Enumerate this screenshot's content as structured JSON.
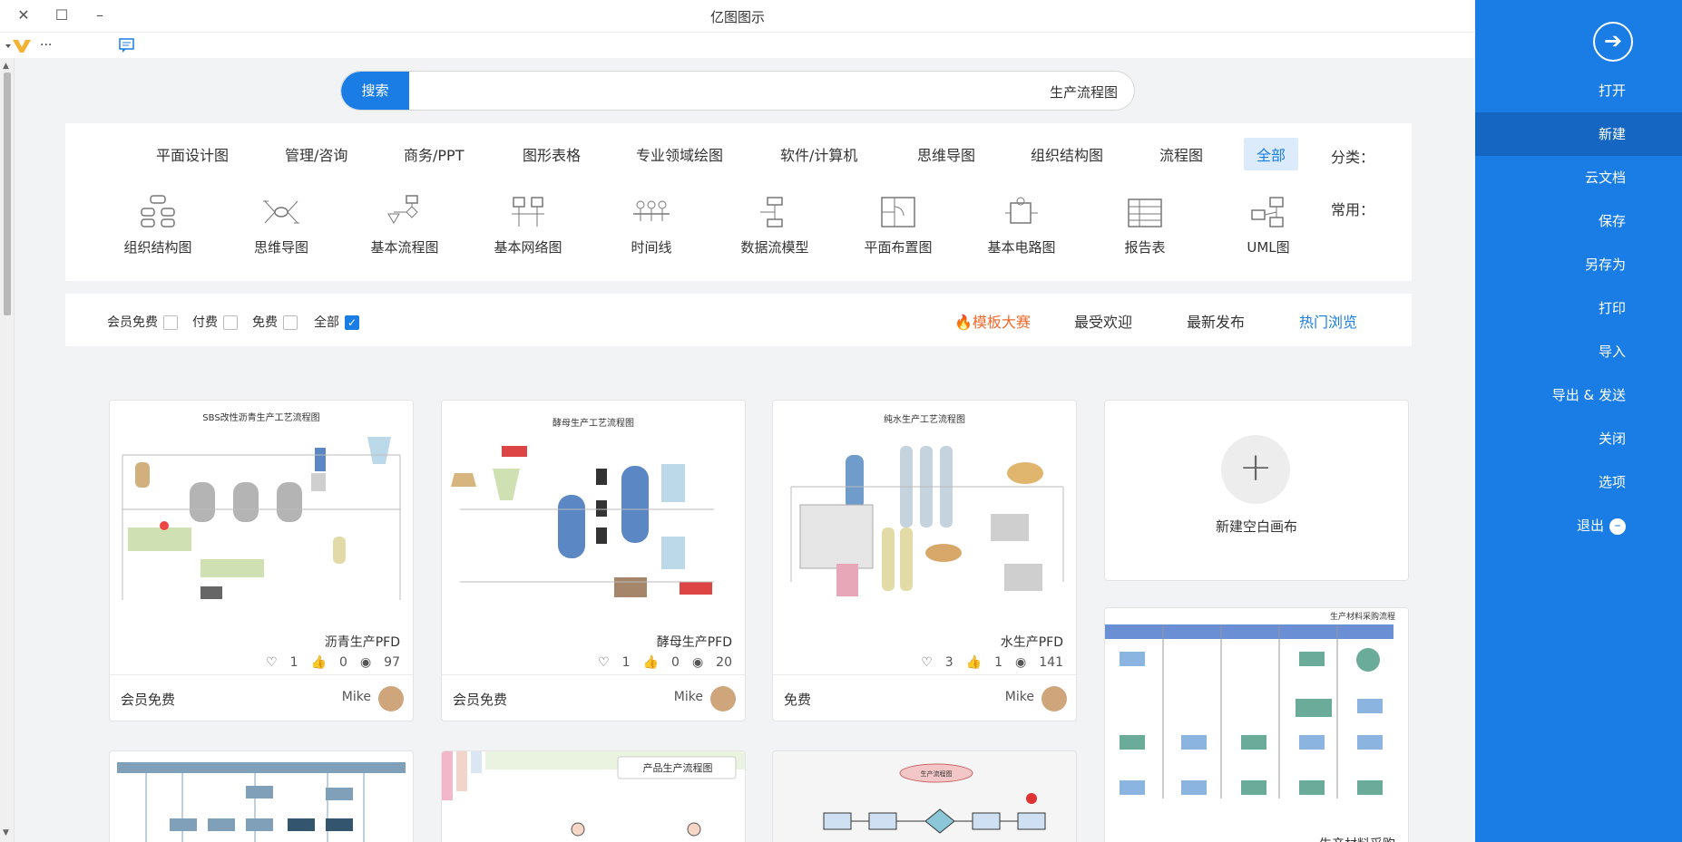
{
  "window": {
    "title": "亿图图示",
    "close": "✕",
    "maximize": "☐",
    "minimize": "–",
    "dots": "..."
  },
  "search": {
    "button": "搜索",
    "value": "生产流程图"
  },
  "sidebar": {
    "items": [
      "打开",
      "新建",
      "云文档",
      "保存",
      "另存为",
      "打印",
      "导入",
      "导出 & 发送",
      "关闭",
      "选项",
      "退出"
    ],
    "active": "新建"
  },
  "categories": {
    "label": "分类：",
    "items": [
      "全部",
      "流程图",
      "组织结构图",
      "思维导图",
      "软件/计算机",
      "专业领域绘图",
      "图形表格",
      "商务/PPT",
      "管理/咨询",
      "平面设计图"
    ]
  },
  "common": {
    "label": "常用：",
    "items": [
      "UML图",
      "报告表",
      "基本电路图",
      "平面布置图",
      "数据流模型",
      "时间线",
      "基本网络图",
      "基本流程图",
      "思维导图",
      "组织结构图"
    ]
  },
  "filter": {
    "tabs": [
      "热门浏览",
      "最新发布",
      "最受欢迎",
      "模板大赛"
    ],
    "checks": [
      "全部",
      "免费",
      "付费",
      "会员免费"
    ]
  },
  "new_canvas": {
    "label": "新建空白画布"
  },
  "cards": [
    {
      "title": "水生产PFD",
      "thumb_title": "纯水生产工艺流程图",
      "views": "141",
      "likes": "1",
      "comments": "3",
      "author": "Mike",
      "price": "免费"
    },
    {
      "title": "酵母生产PFD",
      "thumb_title": "酵母生产工艺流程图",
      "views": "20",
      "likes": "0",
      "comments": "1",
      "author": "Mike",
      "price": "会员免费"
    },
    {
      "title": "沥青生产PFD",
      "thumb_title": "SBS改性沥青生产工艺流程图",
      "views": "97",
      "likes": "0",
      "comments": "1",
      "author": "Mike",
      "price": "会员免费"
    }
  ],
  "bottom_cards": {
    "right_header": "生产材料采购流程",
    "right_title": "生产材料采购",
    "mid2_label": "产品生产流程图",
    "mid1_node": "生产流程图"
  },
  "colors": {
    "accent": "#1a7de6",
    "hot": "#f2692b"
  }
}
